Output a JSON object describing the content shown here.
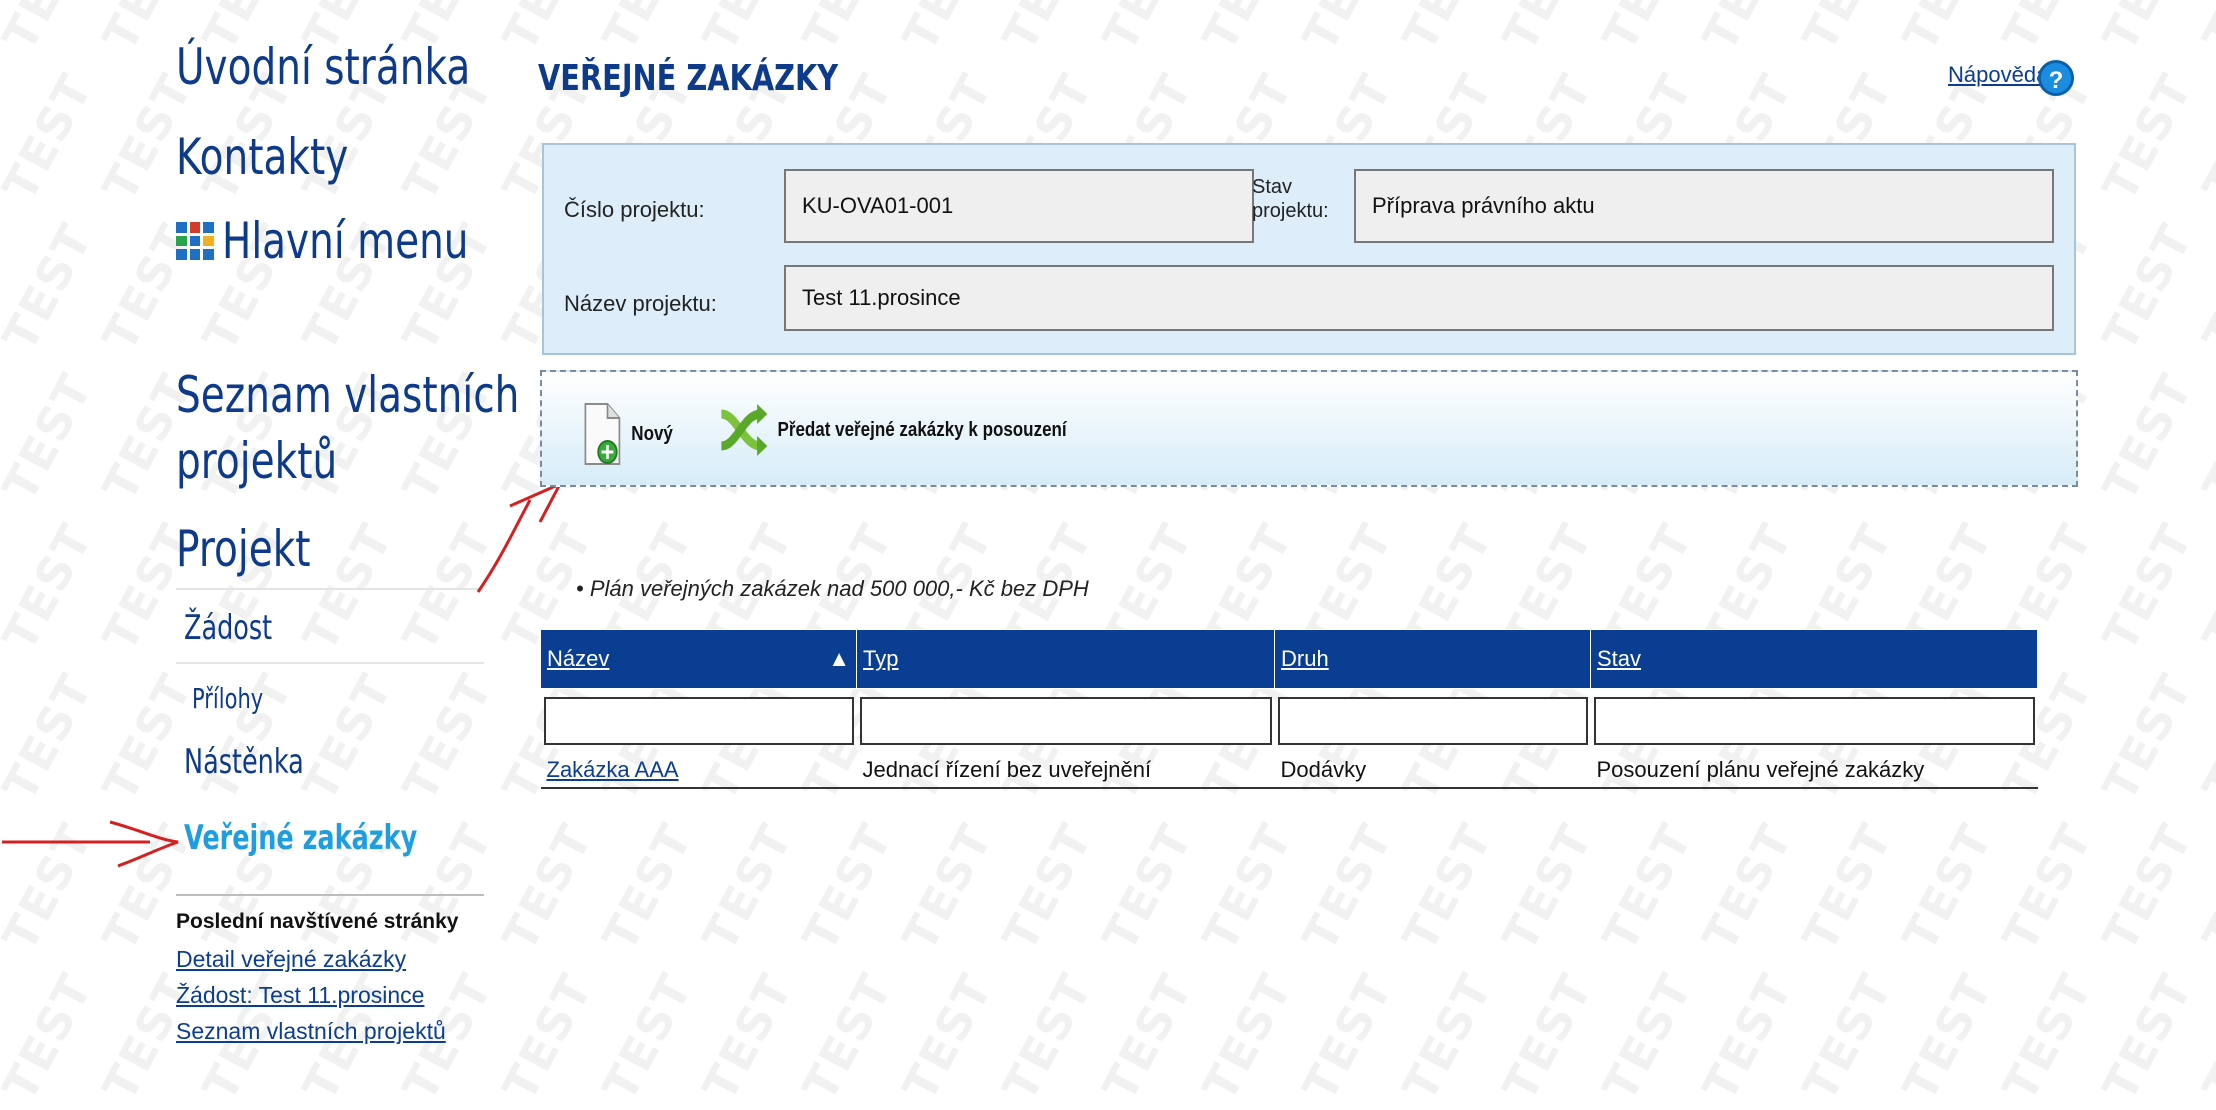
{
  "sidebar": {
    "home": "Úvodní stránka",
    "contacts": "Kontakty",
    "main_menu": "Hlavní menu",
    "own_projects": [
      "Seznam vlastních",
      "projektů"
    ],
    "project": "Projekt",
    "items": [
      {
        "label": "Žádost"
      },
      {
        "label": "Přílohy"
      },
      {
        "label": "Nástěnka"
      },
      {
        "label": "Veřejné zakázky"
      }
    ],
    "recent_title": "Poslední navštívené stránky",
    "recent": [
      "Detail veřejné zakázky",
      "Žádost: Test 11.prosince",
      "Seznam vlastních projektů"
    ]
  },
  "page": {
    "title": "VEŘEJNÉ ZAKÁZKY",
    "help": "Nápověda",
    "help_icon": "question-icon"
  },
  "project": {
    "number_label": "Číslo projektu:",
    "number": "KU-OVA01-001",
    "status_label": [
      "Stav",
      "projektu:"
    ],
    "status": "Příprava právního aktu",
    "name_label": "Název projektu:",
    "name": "Test 11.prosince"
  },
  "toolbar": {
    "new_label": "Nový",
    "submit_label": "Předat veřejné zakázky k posouzení"
  },
  "plan_note": "Plán veřejných zakázek nad 500 000,- Kč bez DPH",
  "table": {
    "columns": [
      "Název",
      "Typ",
      "Druh",
      "Stav"
    ],
    "sort_indicator": "▲",
    "rows": [
      [
        "Zakázka AAA",
        "Jednací řízení bez uveřejnění",
        "Dodávky",
        "Posouzení plánu veřejné zakázky"
      ]
    ]
  },
  "watermark": "TEST",
  "colors": {
    "header_blue": "#0a3e93",
    "active_item": "#1e9ee0",
    "annotation_red": "#d42020"
  }
}
